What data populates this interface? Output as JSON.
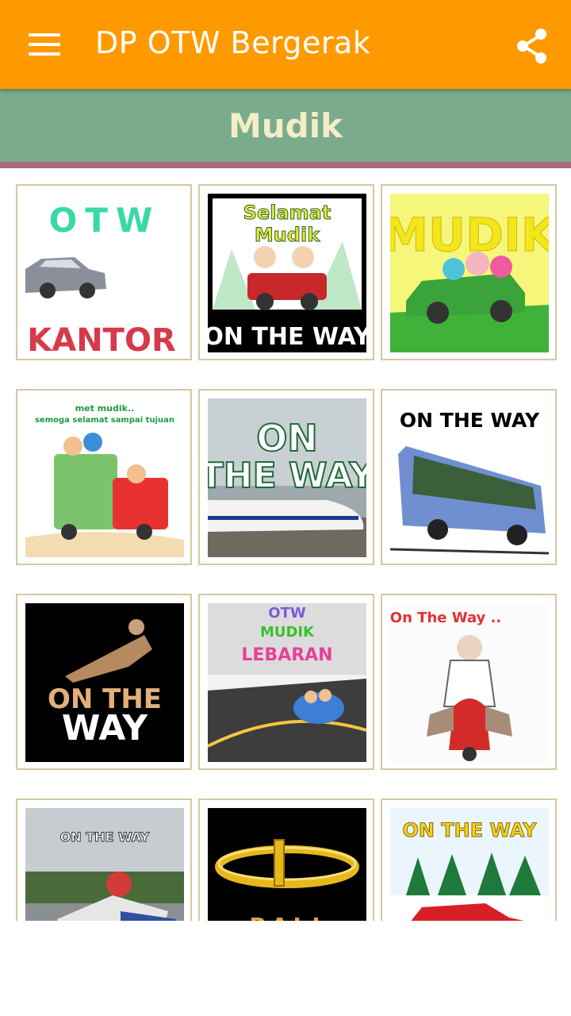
{
  "app_bar": {
    "title": "DP OTW Bergerak",
    "menu_icon": "hamburger-menu-icon",
    "share_icon": "share-icon",
    "color": "#fe9a00"
  },
  "category": {
    "title": "Mudik",
    "background": "#7aab8d",
    "accent_line": "#a86a7c"
  },
  "stickers": [
    {
      "line1": "OTW",
      "line2": "KANTOR"
    },
    {
      "line1": "Selamat",
      "line2": "Mudik",
      "line3": "ON THE WAY"
    },
    {
      "line1": "MUDIK"
    },
    {
      "line1": "met mudik..",
      "line2": "semoga selamat sampai tujuan"
    },
    {
      "line1": "ON",
      "line2": "THE WAY"
    },
    {
      "line1": "ON THE WAY"
    },
    {
      "line1": "ON THE",
      "line2": "WAY"
    },
    {
      "line1": "OTW",
      "line2": "MUDIK",
      "line3": "LEBARAN"
    },
    {
      "line1": "On The Way .."
    },
    {
      "line1": "ON THE WAY"
    },
    {
      "line1": "BALI"
    },
    {
      "line1": "ON THE WAY"
    }
  ]
}
